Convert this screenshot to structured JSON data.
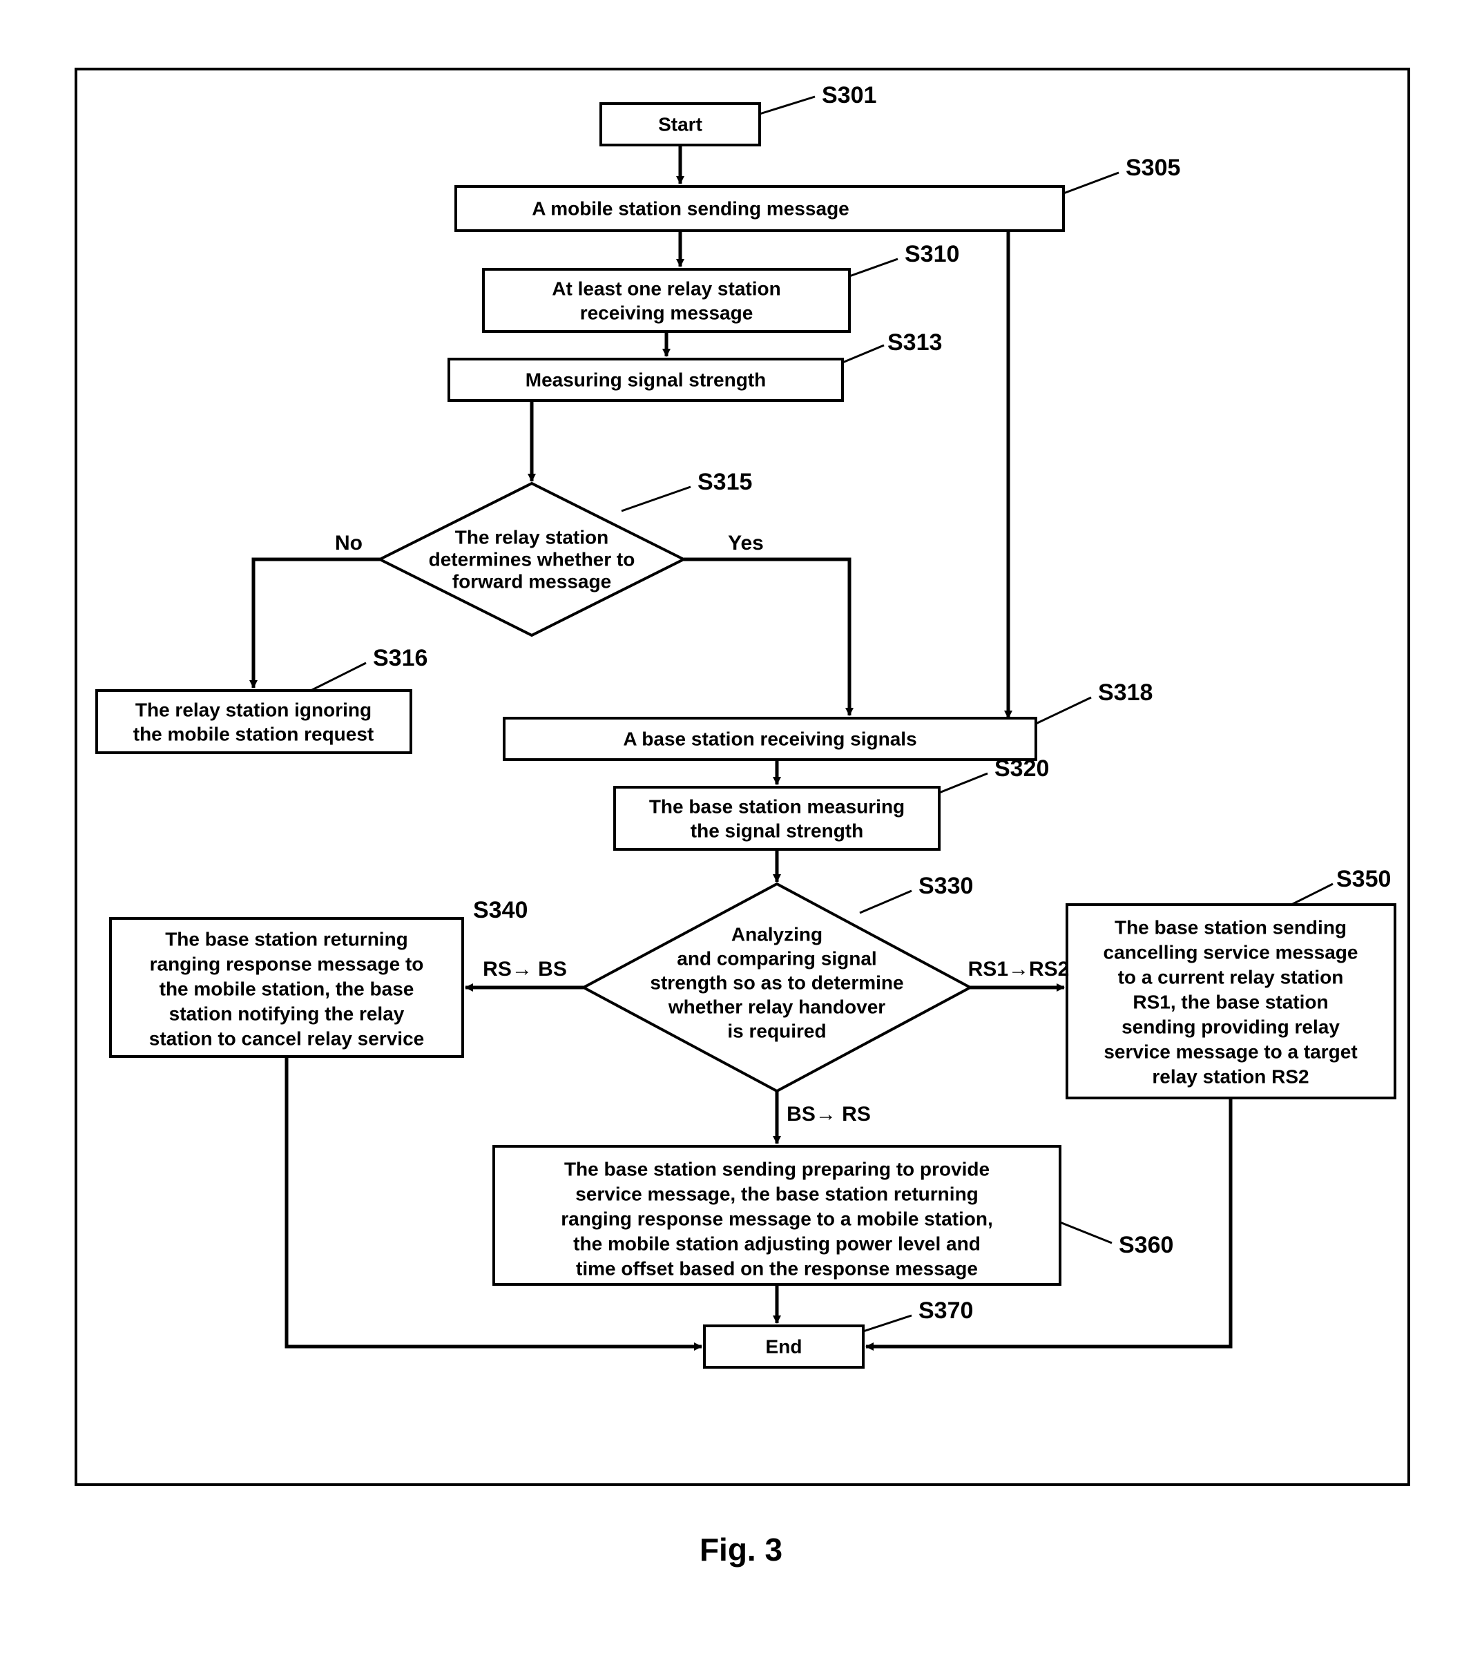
{
  "chart_data": {
    "type": "flowchart",
    "title": "Fig. 3",
    "nodes": [
      {
        "id": "S301",
        "label": "S301",
        "text": [
          "Start"
        ],
        "shape": "rect"
      },
      {
        "id": "S305",
        "label": "S305",
        "text": [
          "A mobile station sending message"
        ],
        "shape": "rect"
      },
      {
        "id": "S310",
        "label": "S310",
        "text": [
          "At least one relay station",
          "receiving message"
        ],
        "shape": "rect"
      },
      {
        "id": "S313",
        "label": "S313",
        "text": [
          "Measuring signal strength"
        ],
        "shape": "rect"
      },
      {
        "id": "S315",
        "label": "S315",
        "text": [
          "The relay station",
          "determines whether to",
          "forward message"
        ],
        "shape": "diamond"
      },
      {
        "id": "S316",
        "label": "S316",
        "text": [
          "The relay station ignoring",
          "the mobile station request"
        ],
        "shape": "rect"
      },
      {
        "id": "S318",
        "label": "S318",
        "text": [
          "A  base station receiving signals"
        ],
        "shape": "rect"
      },
      {
        "id": "S320",
        "label": "S320",
        "text": [
          "The base station measuring",
          "the signal strength"
        ],
        "shape": "rect"
      },
      {
        "id": "S330",
        "label": "S330",
        "text": [
          "Analyzing",
          "and comparing signal",
          "strength so as to determine",
          "whether relay handover",
          "is required"
        ],
        "shape": "diamond"
      },
      {
        "id": "S340",
        "label": "S340",
        "text": [
          "The base station returning",
          "ranging response message to",
          "the mobile station, the base",
          "station notifying the relay",
          "station to cancel relay service"
        ],
        "shape": "rect"
      },
      {
        "id": "S350",
        "label": "S350",
        "text": [
          "The base station sending",
          "cancelling service message",
          "to a current relay station",
          "RS1, the base station",
          "sending providing relay",
          "service message to a target",
          "relay station RS2"
        ],
        "shape": "rect"
      },
      {
        "id": "S360",
        "label": "S360",
        "text": [
          "The base station sending preparing to provide",
          "service message, the base station returning",
          "ranging response message to a mobile station,",
          "the mobile station adjusting power level and",
          "time offset based on the response message"
        ],
        "shape": "rect"
      },
      {
        "id": "S370",
        "label": "S370",
        "text": [
          "End"
        ],
        "shape": "rect"
      }
    ],
    "edges": [
      {
        "from": "S301",
        "to": "S305"
      },
      {
        "from": "S305",
        "to": "S310"
      },
      {
        "from": "S305",
        "to": "S318",
        "note": "direct path"
      },
      {
        "from": "S310",
        "to": "S313"
      },
      {
        "from": "S313",
        "to": "S315"
      },
      {
        "from": "S315",
        "to": "S316",
        "label": "No"
      },
      {
        "from": "S315",
        "to": "S318",
        "label": "Yes"
      },
      {
        "from": "S318",
        "to": "S320"
      },
      {
        "from": "S320",
        "to": "S330"
      },
      {
        "from": "S330",
        "to": "S340",
        "label": "RS→ BS"
      },
      {
        "from": "S330",
        "to": "S350",
        "label": "RS1→RS2"
      },
      {
        "from": "S330",
        "to": "S360",
        "label": "BS→ RS"
      },
      {
        "from": "S340",
        "to": "S370"
      },
      {
        "from": "S350",
        "to": "S370"
      },
      {
        "from": "S360",
        "to": "S370"
      }
    ]
  },
  "labels": {
    "no": "No",
    "yes": "Yes",
    "rs_bs": "RS→ BS",
    "bs_rs": "BS→ RS",
    "rs1_rs2": "RS1→RS2"
  },
  "figure": "Fig. 3"
}
